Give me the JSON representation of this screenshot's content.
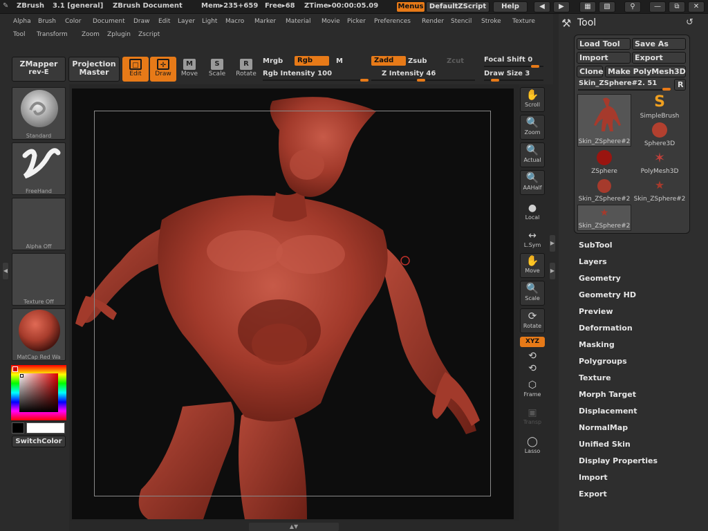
{
  "titlebar": {
    "app": "ZBrush",
    "version": "3.1 [general]",
    "doc": "ZBrush Document",
    "mem": "Mem▸235+659",
    "free": "Free▸68",
    "ztime": "ZTime▸00:00:05.09",
    "menus_btn": "Menus",
    "script_btn": "DefaultZScript",
    "help_btn": "Help"
  },
  "menu_row1": [
    "Alpha",
    "Brush",
    "Color",
    "Document",
    "Draw",
    "Edit",
    "Layer",
    "Light",
    "Macro",
    "Marker",
    "Material",
    "Movie",
    "Picker",
    "Preferences",
    "Render",
    "Stencil",
    "Stroke",
    "Texture"
  ],
  "menu_row2": [
    "Tool",
    "Transform",
    "Zoom",
    "Zplugin",
    "Zscript"
  ],
  "shelf": {
    "zmapper_line1": "ZMapper",
    "zmapper_line2": "rev-E",
    "projection_line1": "Projection",
    "projection_line2": "Master",
    "tools": [
      {
        "label": "Edit",
        "glyph": "□",
        "active": true
      },
      {
        "label": "Draw",
        "glyph": "✛",
        "active": true
      },
      {
        "label": "Move",
        "glyph": "M",
        "active": false
      },
      {
        "label": "Scale",
        "glyph": "S",
        "active": false
      },
      {
        "label": "Rotate",
        "glyph": "R",
        "active": false
      }
    ],
    "mrgb": "Mrgb",
    "rgb": "Rgb",
    "m": "M",
    "zadd": "Zadd",
    "zsub": "Zsub",
    "zcut": "Zcut",
    "rgb_intensity": "Rgb Intensity 100",
    "z_intensity": "Z Intensity 46",
    "focal_shift": "Focal Shift 0",
    "draw_size": "Draw Size 3"
  },
  "left_tray": {
    "brush": "Standard",
    "stroke": "FreeHand",
    "alpha": "Alpha Off",
    "texture": "Texture Off",
    "material": "MatCap Red Wa",
    "switch_color": "SwitchColor"
  },
  "right_tray": [
    "Scroll",
    "Zoom",
    "Actual",
    "AAHalf",
    "Local",
    "L.Sym",
    "Move",
    "Scale",
    "Rotate",
    "XYZ",
    "Frame",
    "Transp",
    "Lasso"
  ],
  "tool_palette": {
    "title": "Tool",
    "load_tool": "Load Tool",
    "save_as": "Save As",
    "import": "Import",
    "export": "Export",
    "clone": "Clone",
    "make_polymesh": "Make PolyMesh3D",
    "current_tool": "Skin_ZSphere#2. 51",
    "r_btn": "R",
    "tools": [
      "Skin_ZSphere#2",
      "SimpleBrush",
      "Sphere3D",
      "ZSphere",
      "PolyMesh3D",
      "Skin_ZSphere#2",
      "Skin_ZSphere#2",
      "Skin_ZSphere#2"
    ]
  },
  "subpalettes": [
    "SubTool",
    "Layers",
    "Geometry",
    "Geometry HD",
    "Preview",
    "Deformation",
    "Masking",
    "Polygroups",
    "Texture",
    "Morph Target",
    "Displacement",
    "NormalMap",
    "Unified Skin",
    "Display Properties",
    "Import",
    "Export"
  ],
  "colors": {
    "accent": "#e77a18",
    "model": "#a63a2c",
    "background": "#0d0d0d"
  }
}
